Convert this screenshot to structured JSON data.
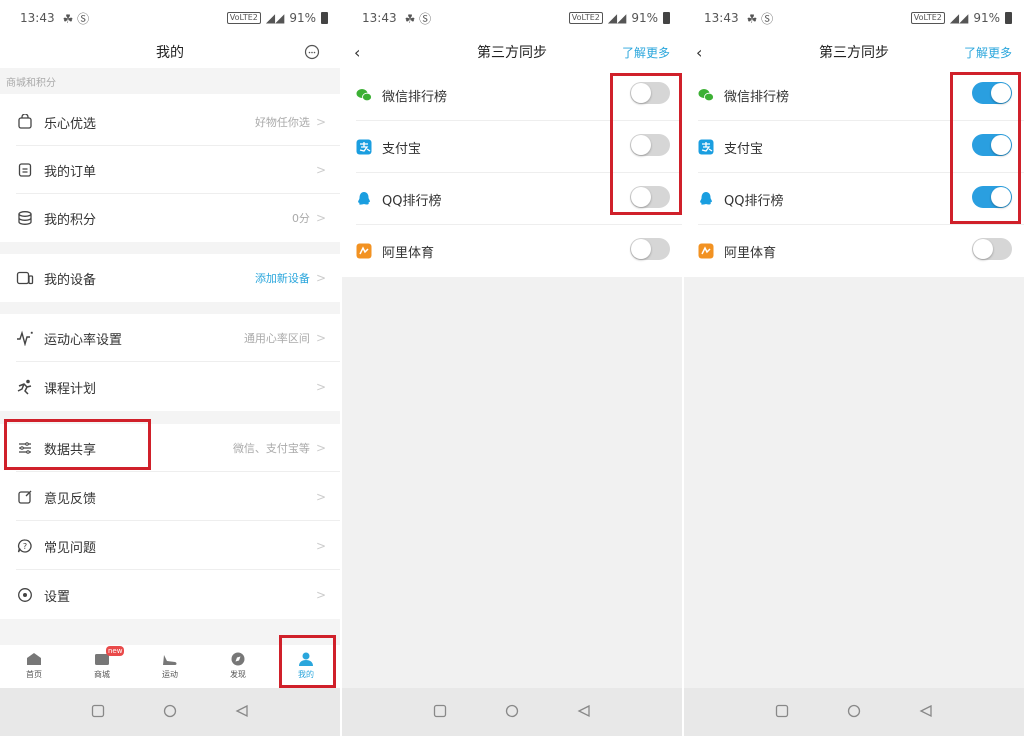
{
  "status": {
    "time": "13:43",
    "volte": "VoLTE2",
    "battery": "91%"
  },
  "panel1": {
    "title": "我的",
    "section_label": "商城和积分",
    "items": [
      {
        "label": "乐心优选",
        "right": "好物任你选"
      },
      {
        "label": "我的订单",
        "right": ""
      },
      {
        "label": "我的积分",
        "right": "0分"
      },
      {
        "label": "我的设备",
        "right": "添加新设备"
      },
      {
        "label": "运动心率设置",
        "right": "通用心率区间"
      },
      {
        "label": "课程计划",
        "right": ""
      },
      {
        "label": "数据共享",
        "right": "微信、支付宝等"
      },
      {
        "label": "意见反馈",
        "right": ""
      },
      {
        "label": "常见问题",
        "right": ""
      },
      {
        "label": "设置",
        "right": ""
      }
    ],
    "tabs": [
      {
        "label": "首页"
      },
      {
        "label": "商城",
        "badge": "new"
      },
      {
        "label": "运动"
      },
      {
        "label": "发现"
      },
      {
        "label": "我的"
      }
    ]
  },
  "panel2": {
    "title": "第三方同步",
    "more": "了解更多",
    "items": [
      {
        "label": "微信排行榜",
        "on": false
      },
      {
        "label": "支付宝",
        "on": false
      },
      {
        "label": "QQ排行榜",
        "on": false
      },
      {
        "label": "阿里体育",
        "on": false
      }
    ]
  },
  "panel3": {
    "title": "第三方同步",
    "more": "了解更多",
    "items": [
      {
        "label": "微信排行榜",
        "on": true
      },
      {
        "label": "支付宝",
        "on": true
      },
      {
        "label": "QQ排行榜",
        "on": true
      },
      {
        "label": "阿里体育",
        "on": false
      }
    ]
  },
  "colors": {
    "accent": "#2aa6dc",
    "highlight_box": "#d0202a",
    "toggle_on": "#2a9fe0",
    "toggle_off": "#d6d6d6"
  }
}
